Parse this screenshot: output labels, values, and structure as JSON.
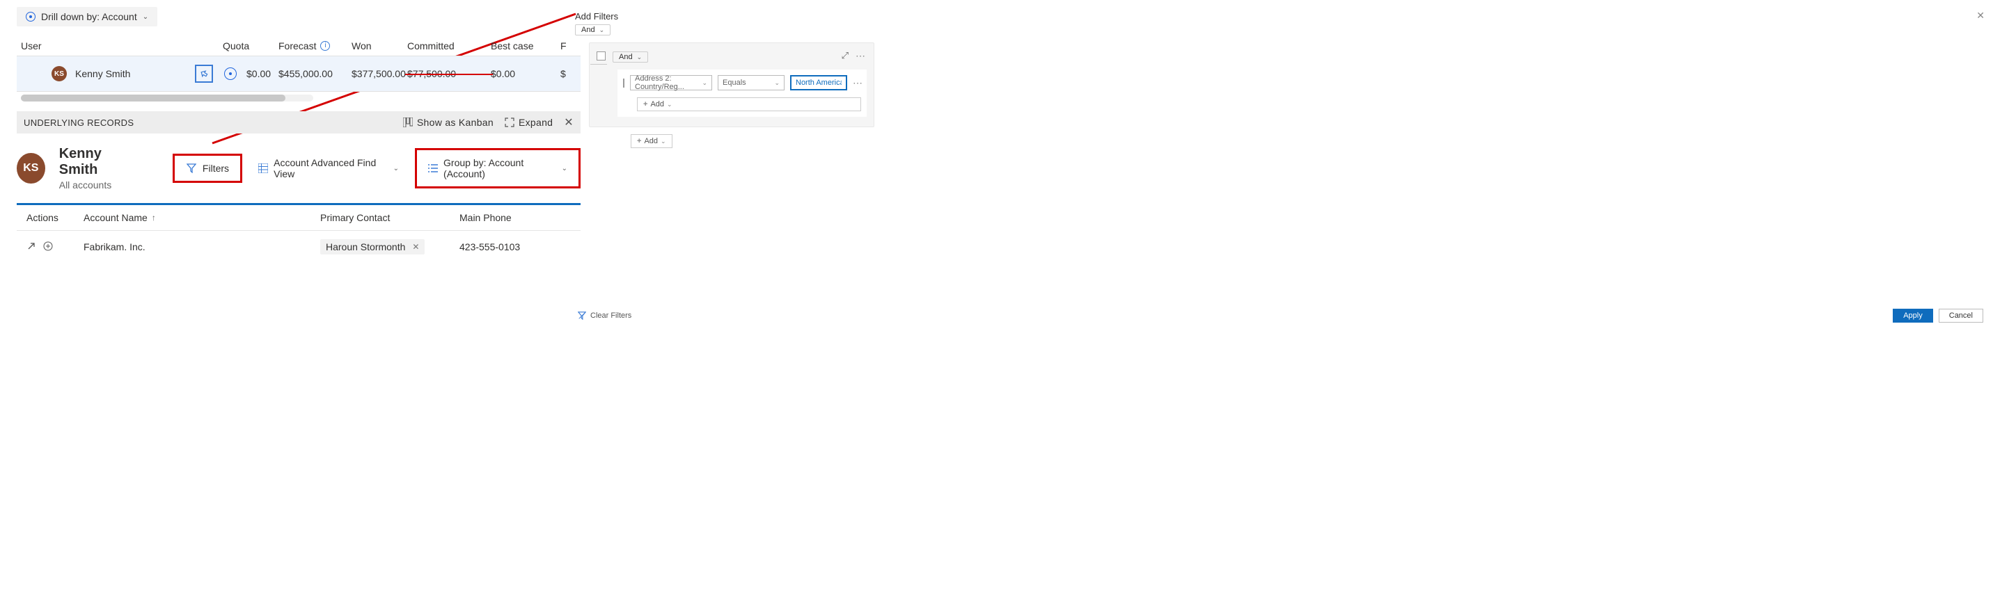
{
  "drill": {
    "label": "Drill down by: Account"
  },
  "columns": {
    "user": "User",
    "quota": "Quota",
    "forecast": "Forecast",
    "won": "Won",
    "committed": "Committed",
    "bestcase": "Best case",
    "more": "F"
  },
  "row": {
    "avatar": "KS",
    "name": "Kenny Smith",
    "quota": "$0.00",
    "forecast": "$455,000.00",
    "won": "$377,500.00",
    "committed": "$77,500.00",
    "bestcase": "$0.00",
    "more": "$"
  },
  "underlying": {
    "title": "UNDERLYING RECORDS",
    "kanban": "Show as Kanban",
    "expand": "Expand"
  },
  "record": {
    "avatar": "KS",
    "name": "Kenny Smith",
    "sub": "All accounts"
  },
  "toolbar": {
    "filters": "Filters",
    "view": "Account Advanced Find View",
    "groupby": "Group by:  Account (Account)"
  },
  "tableHead": {
    "actions": "Actions",
    "account": "Account Name",
    "primary": "Primary Contact",
    "phone": "Main Phone"
  },
  "tableRow": {
    "account": "Fabrikam. Inc.",
    "contact": "Haroun Stormonth",
    "phone": "423-555-0103"
  },
  "filterPanel": {
    "title": "Add Filters",
    "and": "And",
    "field": "Address 2: Country/Reg...",
    "op": "Equals",
    "value": "North America",
    "add": "Add",
    "clear": "Clear Filters",
    "apply": "Apply",
    "cancel": "Cancel"
  }
}
